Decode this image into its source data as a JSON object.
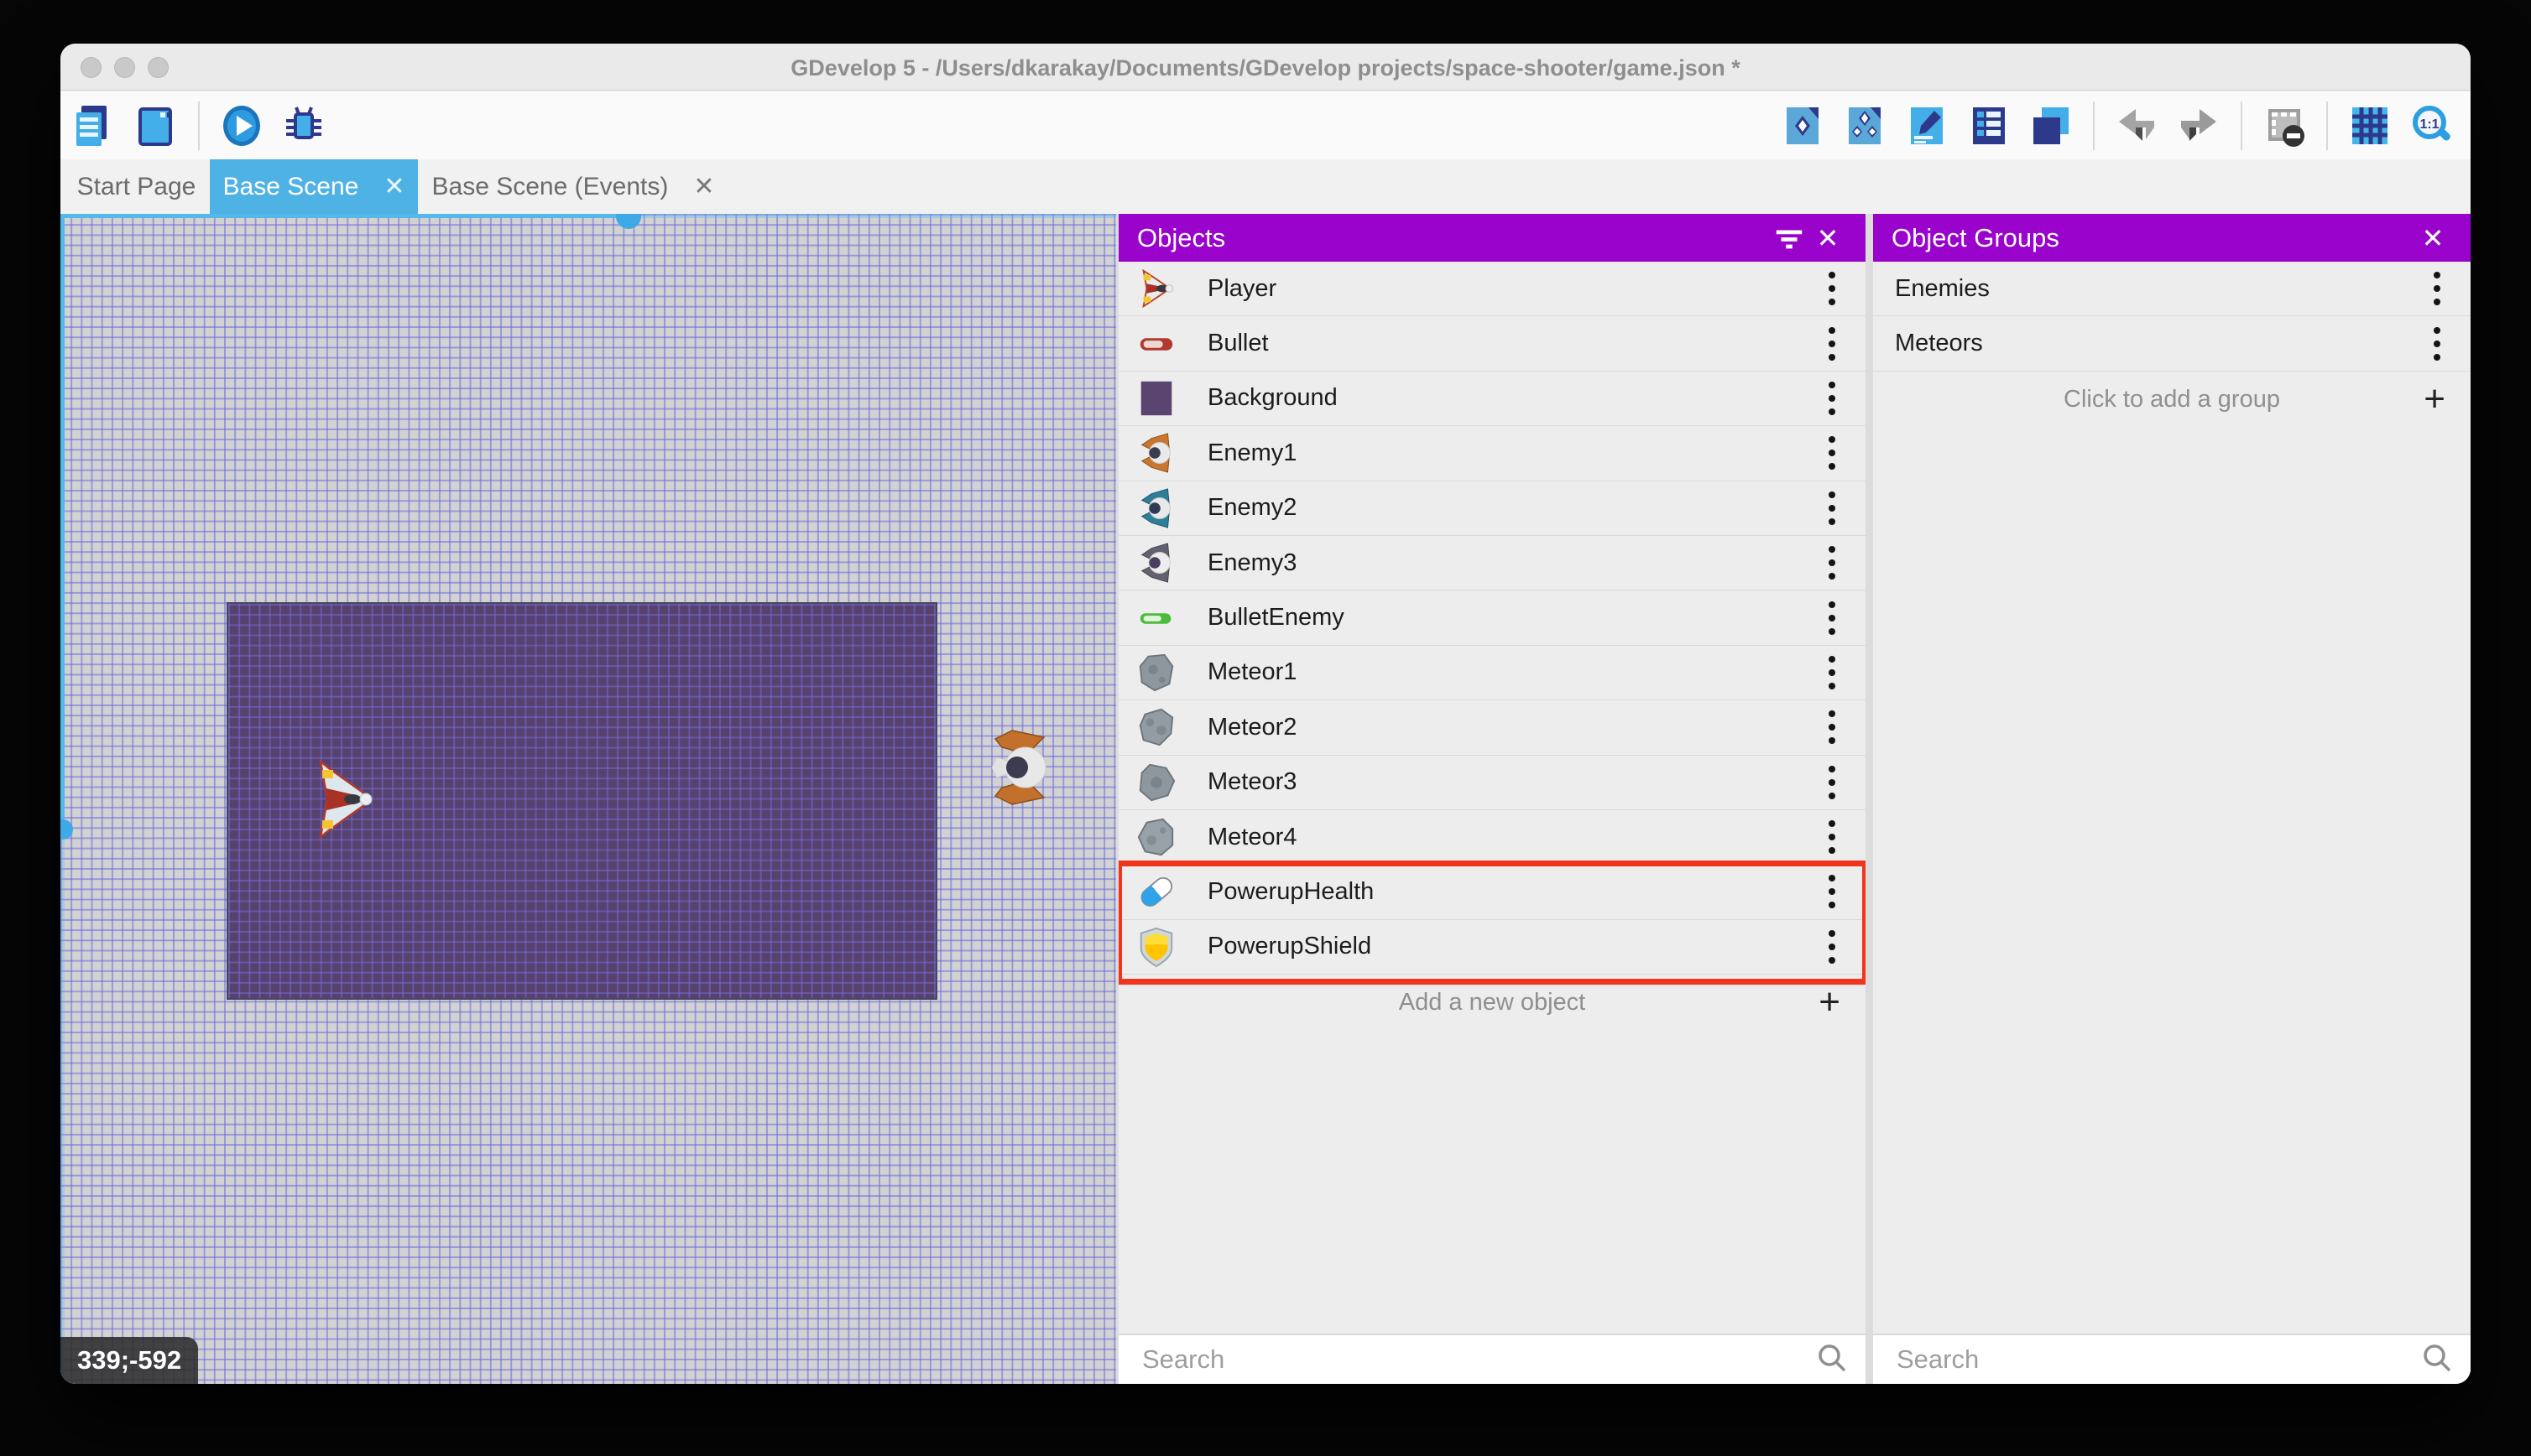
{
  "window": {
    "title": "GDevelop 5 - /Users/dkarakay/Documents/GDevelop projects/space-shooter/game.json *"
  },
  "toolbar": {
    "left_icons": [
      "project-manager-icon",
      "preview-window-icon",
      "play-preview-icon",
      "debugger-icon"
    ],
    "right_icons": [
      "instance-properties-icon",
      "objects-list-icon",
      "edit-scene-icon",
      "instances-list-icon",
      "layers-icon",
      "undo-icon",
      "redo-icon",
      "mask-toggle-icon",
      "grid-toggle-icon",
      "zoom-ratio-icon"
    ],
    "zoom_ratio": "1:1"
  },
  "tabs": [
    {
      "label": "Start Page",
      "active": false,
      "closable": false
    },
    {
      "label": "Base Scene",
      "active": true,
      "closable": true
    },
    {
      "label": "Base Scene (Events)",
      "active": false,
      "closable": true
    }
  ],
  "canvas": {
    "coordinates": "339;-592"
  },
  "objects_panel": {
    "title": "Objects",
    "objects": [
      {
        "name": "Player",
        "icon": "player"
      },
      {
        "name": "Bullet",
        "icon": "bullet"
      },
      {
        "name": "Background",
        "icon": "background"
      },
      {
        "name": "Enemy1",
        "icon": "enemy1"
      },
      {
        "name": "Enemy2",
        "icon": "enemy2"
      },
      {
        "name": "Enemy3",
        "icon": "enemy3"
      },
      {
        "name": "BulletEnemy",
        "icon": "bulletenemy"
      },
      {
        "name": "Meteor1",
        "icon": "meteor1"
      },
      {
        "name": "Meteor2",
        "icon": "meteor2"
      },
      {
        "name": "Meteor3",
        "icon": "meteor3"
      },
      {
        "name": "Meteor4",
        "icon": "meteor4"
      },
      {
        "name": "PowerupHealth",
        "icon": "powerup-health"
      },
      {
        "name": "PowerupShield",
        "icon": "powerup-shield"
      }
    ],
    "highlighted_rows": [
      "PowerupHealth",
      "PowerupShield"
    ],
    "add_label": "Add a new object",
    "search_placeholder": "Search"
  },
  "groups_panel": {
    "title": "Object Groups",
    "groups": [
      {
        "name": "Enemies"
      },
      {
        "name": "Meteors"
      }
    ],
    "add_label": "Click to add a group",
    "search_placeholder": "Search"
  },
  "colors": {
    "panel_header": "#9903CB",
    "tab_active": "#4FB2E5",
    "highlight": "#F1341C",
    "scene_line": "#53B9EA",
    "canvas_bg": "#D2D2D2",
    "scene_bg_rect": "#57426E"
  }
}
